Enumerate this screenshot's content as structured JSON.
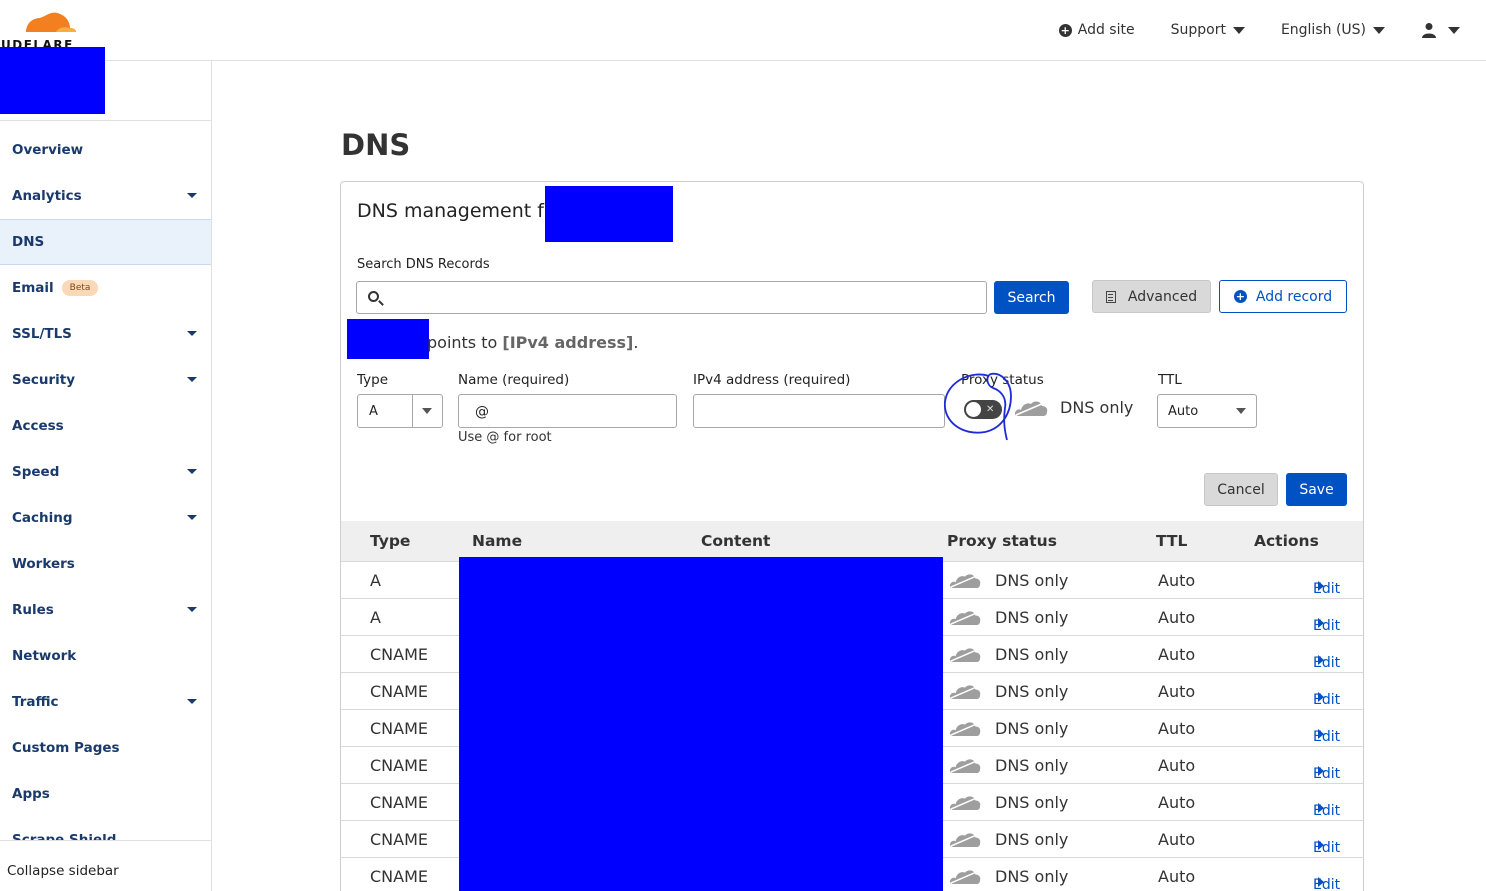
{
  "brand": {
    "logo_text": "UDFLARE",
    "accent": "#f38020"
  },
  "header": {
    "add_site": "Add site",
    "support": "Support",
    "language": "English (US)"
  },
  "sidebar": {
    "items": [
      {
        "label": "Overview",
        "chevron": false
      },
      {
        "label": "Analytics",
        "chevron": true
      },
      {
        "label": "DNS",
        "chevron": false,
        "active": true
      },
      {
        "label": "Email",
        "chevron": false,
        "badge": "Beta"
      },
      {
        "label": "SSL/TLS",
        "chevron": true
      },
      {
        "label": "Security",
        "chevron": true
      },
      {
        "label": "Access",
        "chevron": false
      },
      {
        "label": "Speed",
        "chevron": true
      },
      {
        "label": "Caching",
        "chevron": true
      },
      {
        "label": "Workers",
        "chevron": false
      },
      {
        "label": "Rules",
        "chevron": true
      },
      {
        "label": "Network",
        "chevron": false
      },
      {
        "label": "Traffic",
        "chevron": true
      },
      {
        "label": "Custom Pages",
        "chevron": false
      },
      {
        "label": "Apps",
        "chevron": false
      },
      {
        "label": "Scrape Shield",
        "chevron": false
      }
    ],
    "collapse": "Collapse sidebar"
  },
  "page": {
    "title": "DNS"
  },
  "card": {
    "title": "DNS management fo",
    "search_label": "Search DNS Records",
    "search_value": "",
    "search_button": "Search",
    "advanced_button": "Advanced",
    "add_record_button": "Add record",
    "hint_prefix": "points to ",
    "hint_placeholder": "[IPv4 address]",
    "hint_suffix": "."
  },
  "form": {
    "type_label": "Type",
    "type_value": "A",
    "name_label": "Name (required)",
    "name_value": "@",
    "name_hint": "Use @ for root",
    "ip_label": "IPv4 address (required)",
    "ip_value": "",
    "proxy_label": "Proxy status",
    "proxy_value": "DNS only",
    "ttl_label": "TTL",
    "ttl_value": "Auto",
    "cancel": "Cancel",
    "save": "Save"
  },
  "table": {
    "headers": [
      "Type",
      "Name",
      "Content",
      "Proxy status",
      "TTL",
      "Actions"
    ],
    "rows": [
      {
        "type": "A",
        "proxy": "DNS only",
        "ttl": "Auto",
        "action": "Edit"
      },
      {
        "type": "A",
        "proxy": "DNS only",
        "ttl": "Auto",
        "action": "Edit"
      },
      {
        "type": "CNAME",
        "proxy": "DNS only",
        "ttl": "Auto",
        "action": "Edit"
      },
      {
        "type": "CNAME",
        "proxy": "DNS only",
        "ttl": "Auto",
        "action": "Edit"
      },
      {
        "type": "CNAME",
        "proxy": "DNS only",
        "ttl": "Auto",
        "action": "Edit"
      },
      {
        "type": "CNAME",
        "proxy": "DNS only",
        "ttl": "Auto",
        "action": "Edit"
      },
      {
        "type": "CNAME",
        "proxy": "DNS only",
        "ttl": "Auto",
        "action": "Edit"
      },
      {
        "type": "CNAME",
        "proxy": "DNS only",
        "ttl": "Auto",
        "action": "Edit"
      },
      {
        "type": "CNAME",
        "proxy": "DNS only",
        "ttl": "Auto",
        "action": "Edit"
      }
    ]
  }
}
